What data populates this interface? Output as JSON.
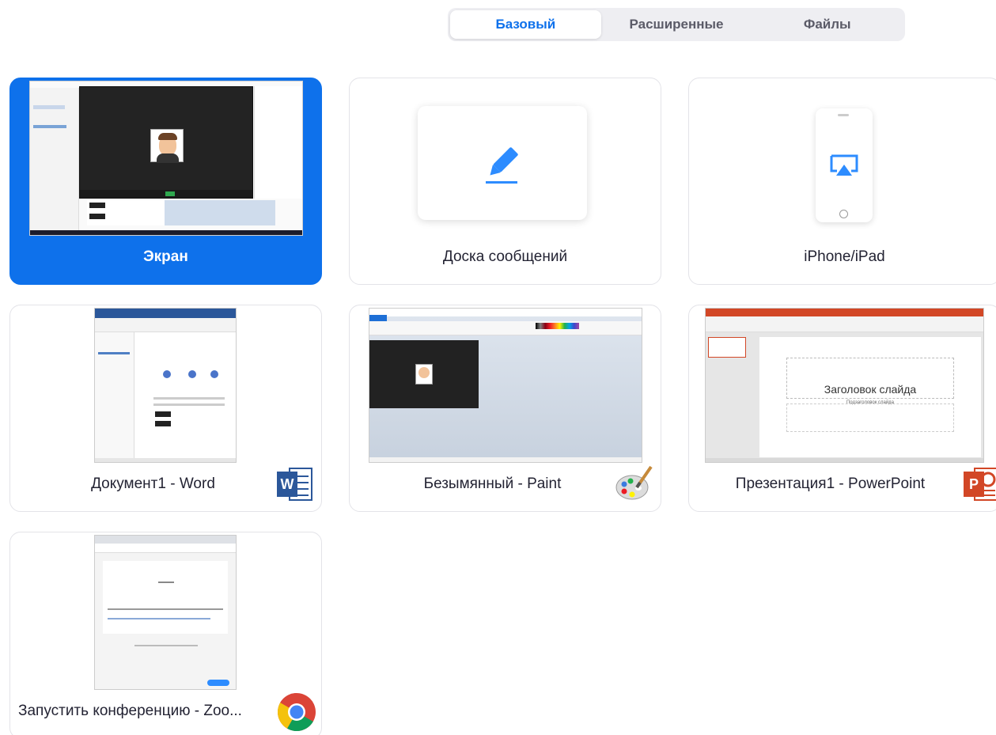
{
  "tabs": [
    {
      "label": "Базовый",
      "active": true
    },
    {
      "label": "Расширенные",
      "active": false
    },
    {
      "label": "Файлы",
      "active": false
    }
  ],
  "cards": {
    "screen": {
      "label": "Экран"
    },
    "whiteboard": {
      "label": "Доска сообщений"
    },
    "iphone": {
      "label": "iPhone/iPad"
    },
    "word": {
      "label": "Документ1 - Word",
      "app_icon": "word-icon",
      "icon_letter": "W"
    },
    "paint": {
      "label": "Безымянный - Paint",
      "app_icon": "paint-palette-icon"
    },
    "powerpoint": {
      "label": "Презентация1 - PowerPoint",
      "app_icon": "powerpoint-icon",
      "icon_letter": "P",
      "slide_title": "Заголовок слайда",
      "slide_subtitle": "Подзаголовок слайда"
    },
    "chrome": {
      "label": "Запустить конференцию - Zoo...",
      "app_icon": "chrome-icon"
    }
  },
  "colors": {
    "accent": "#0e71eb",
    "word": "#2b579a",
    "powerpoint": "#d24726",
    "chrome_red": "#db4437",
    "chrome_yellow": "#f4c20d",
    "chrome_green": "#0f9d58",
    "chrome_blue": "#4285f4"
  }
}
